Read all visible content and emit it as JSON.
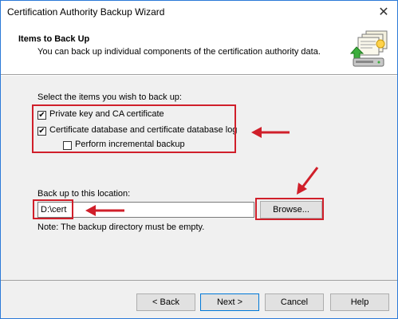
{
  "window": {
    "title": "Certification Authority Backup Wizard"
  },
  "header": {
    "title": "Items to Back Up",
    "subtitle": "You can back up individual components of the certification authority data."
  },
  "body": {
    "select_label": "Select the items you wish to back up:",
    "items": [
      {
        "label": "Private key and CA certificate",
        "checked": true,
        "mark": "✔"
      },
      {
        "label": "Certificate database and certificate database log",
        "checked": true,
        "mark": "✔"
      },
      {
        "label": "Perform incremental backup",
        "checked": false,
        "mark": ""
      }
    ],
    "location_label": "Back up to this location:",
    "location_value": "D:\\cert",
    "browse_label": "Browse...",
    "note": "Note: The backup directory must be empty."
  },
  "footer": {
    "back_label": "< Back",
    "next_label": "Next >",
    "cancel_label": "Cancel",
    "help_label": "Help"
  },
  "colors": {
    "annotation_red": "#d01f2a",
    "accent": "#0078d7"
  }
}
